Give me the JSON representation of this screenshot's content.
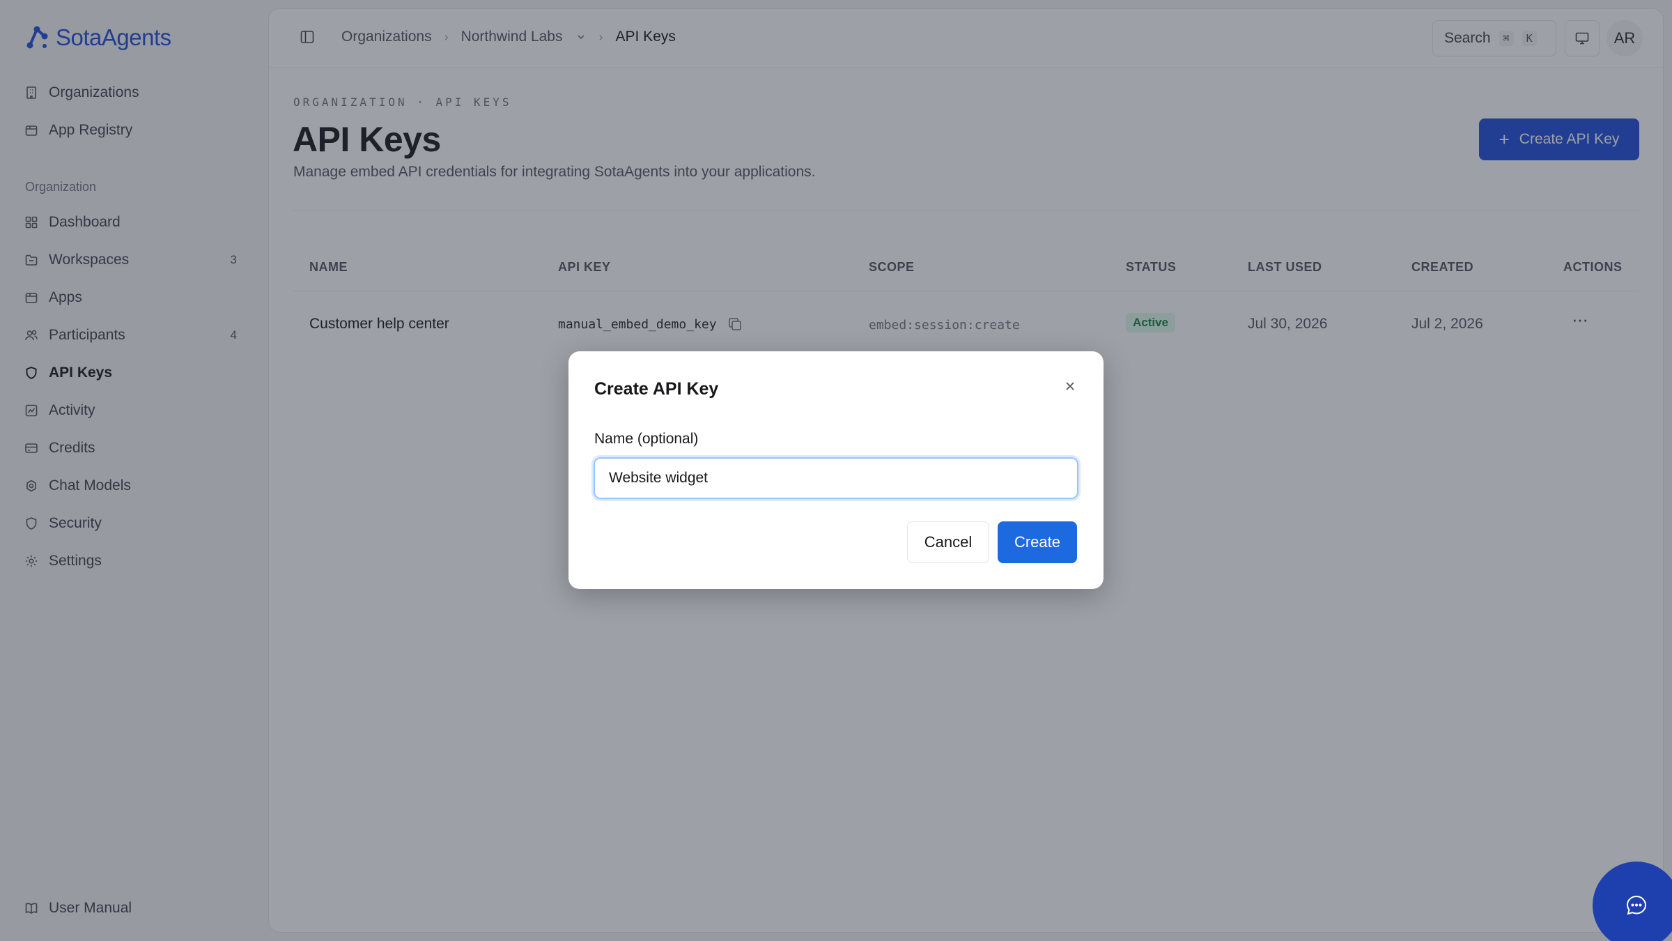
{
  "app": {
    "name": "SotaAgents"
  },
  "sidebar": {
    "top_items": [
      {
        "label": "Organizations",
        "icon": "building-icon"
      },
      {
        "label": "App Registry",
        "icon": "package-icon"
      }
    ],
    "section_label": "Organization",
    "items": [
      {
        "label": "Dashboard",
        "icon": "grid-icon"
      },
      {
        "label": "Workspaces",
        "icon": "folder-icon",
        "count": "3"
      },
      {
        "label": "Apps",
        "icon": "box-icon"
      },
      {
        "label": "Participants",
        "icon": "users-icon",
        "count": "4"
      },
      {
        "label": "API Keys",
        "icon": "shield-icon",
        "active": true
      },
      {
        "label": "Activity",
        "icon": "activity-icon"
      },
      {
        "label": "Credits",
        "icon": "credit-card-icon"
      },
      {
        "label": "Chat Models",
        "icon": "model-icon"
      },
      {
        "label": "Security",
        "icon": "shield-icon"
      },
      {
        "label": "Settings",
        "icon": "gear-icon"
      }
    ],
    "footer": {
      "label": "User Manual",
      "icon": "book-icon"
    }
  },
  "topbar": {
    "breadcrumbs": [
      "Organizations",
      "Northwind Labs",
      "API Keys"
    ],
    "search_label": "Search",
    "search_kbd": [
      "⌘",
      "K"
    ],
    "avatar_initials": "AR"
  },
  "page": {
    "eyebrow": "ORGANIZATION · API KEYS",
    "title": "API Keys",
    "subtitle": "Manage embed API credentials for integrating SotaAgents into your applications.",
    "create_button": "Create API Key"
  },
  "table": {
    "columns": [
      "NAME",
      "API KEY",
      "SCOPE",
      "STATUS",
      "LAST USED",
      "CREATED",
      "ACTIONS"
    ],
    "rows": [
      {
        "name": "Customer help center",
        "api_key": "manual_embed_demo_key",
        "scope": "embed:session:create",
        "status": "Active",
        "last_used": "Jul 30, 2026",
        "created": "Jul 2, 2026"
      }
    ]
  },
  "modal": {
    "title": "Create API Key",
    "field_label": "Name (optional)",
    "field_value": "Website widget",
    "cancel_label": "Cancel",
    "create_label": "Create"
  },
  "colors": {
    "accent": "#1d4ed8",
    "status_active_bg": "#dcfce7",
    "status_active_text": "#15803d"
  }
}
